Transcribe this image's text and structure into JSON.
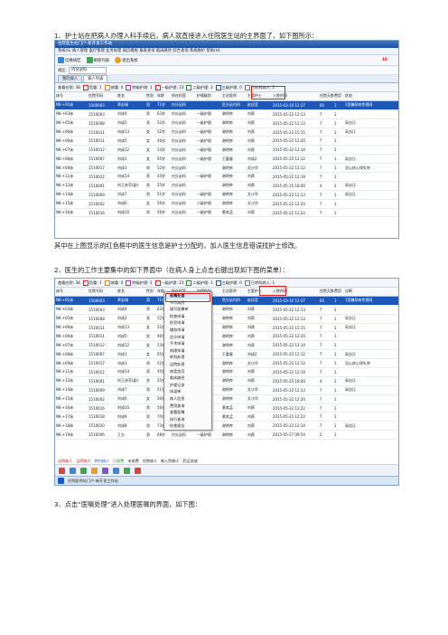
{
  "step1": "1、护士站在把病人办理入科手续后，病人就直接进入住院医生站的主界面了，如下图所示：",
  "caption1": "其中在上图显示的红色框中的医生信息是护士分配的，加入医生信息错误找护士修改。",
  "step2": "2、医生的工作主要集中的如下界面中（在病人身上点击右键出现如下图的菜单）：",
  "step3": "3、点击“医嘱处理”进入处理医嘱的界面，如下图：",
  "shot1": {
    "title": "住院医生站门户-新开发工作站",
    "menu": "系统(S)  病人管理  医疗管理  业务处理  病历模板  报表查询  临床路径  综合查询  系统维护  帮助(H)",
    "toolbar": [
      "切换病区",
      "刷新列表",
      "退出系统"
    ],
    "toolbar_count": "18",
    "filter_label": "病区:",
    "filter_value": "内分泌科",
    "tabs": [
      "我的病人",
      "病人列表"
    ],
    "status": [
      "查看在院: 38",
      "危重: 1",
      "病重: 0",
      "特级护理: 1",
      "一级护理: 23",
      "二级护理: 3",
      "三级护理: 0",
      "已转科病人: 1"
    ],
    "header": [
      "床号",
      "住院号码",
      "姓名",
      "性别",
      "年龄",
      "所在科室",
      "护理级别",
      "主治医师",
      "主管护士",
      "入院时间",
      "住院天数",
      "费用",
      "状态"
    ],
    "rows": [
      [
        "NK-+01床",
        "1500003",
        "茅宏瑞",
        "男",
        "71岁",
        "内分泌科",
        "",
        "危分泌内科",
        "赵佳莹",
        "2015-03-10 12:37",
        "60",
        "1",
        "1型糖尿病性视网"
      ],
      [
        "NK-+03床",
        "1510003",
        "刘成4",
        "男",
        "63岁",
        "内分泌科",
        "一级护理",
        "谢明库",
        "刘燕",
        "2015-05-22 12:13",
        "7",
        "1",
        ""
      ],
      [
        "NK-+05床",
        "1510008",
        "刘成2",
        "男",
        "52岁",
        "内分泌科",
        "一级护理",
        "谢明库",
        "刘燕",
        "2015-05-22 12:13",
        "7",
        "1",
        "高血压"
      ],
      [
        "NK-+06床",
        "1510011",
        "刘成13",
        "女",
        "52岁",
        "内分泌科",
        "一级护理",
        "谢明库",
        "刘燕",
        "2015-05-22 15:15",
        "7",
        "1",
        "高血压"
      ],
      [
        "NK-+06床",
        "1510011",
        "刘成5",
        "女",
        "46岁",
        "内分泌科",
        "一级护理",
        "谢明库",
        "刘燕",
        "2015-05-22 12:20",
        "7",
        "1",
        ""
      ],
      [
        "NK-+07床",
        "1510012",
        "刘成12",
        "女",
        "53岁",
        "内分泌科",
        "一级护理",
        "谢明库",
        "刘燕",
        "2015-05-22 12:14",
        "7",
        "1",
        ""
      ],
      [
        "NK-+08床",
        "1510007",
        "刘成1",
        "女",
        "65岁",
        "内分泌科",
        "一级护理",
        "王重春",
        "刘成2",
        "2015-05-22 12:12",
        "7",
        "1",
        "高血压"
      ],
      [
        "NK-+09床",
        "1510017",
        "刘成3",
        "男",
        "52岁",
        "内分泌科",
        "",
        "谢明库",
        "文沙华",
        "2015-05-22 12:12",
        "7",
        "1",
        "冠心病心律失常"
      ],
      [
        "NK-+11床",
        "1510022",
        "刘成14",
        "男",
        "45岁",
        "内分泌科",
        "一级护理",
        "谢明库",
        "刘燕",
        "2015-05-22 12:19",
        "7",
        "1",
        ""
      ],
      [
        "NK-+12床",
        "1510001",
        "刘王彦芬(副)",
        "男",
        "25岁",
        "内分泌科",
        "",
        "谢明库",
        "刘燕",
        "2015-05-25 18:40",
        "4",
        "1",
        "高血压"
      ],
      [
        "NK-+14床",
        "1510009",
        "刘成7",
        "男",
        "51岁",
        "内分泌科",
        "一级护理",
        "谢明库",
        "文沙华",
        "2015-05-22 12:13",
        "7",
        "1",
        "高血压"
      ],
      [
        "NK-+15床",
        "1510002",
        "刘成6",
        "女",
        "56岁",
        "内分泌科",
        "二级护理",
        "谢明库",
        "文沙华",
        "2015-05-22 12:20",
        "7",
        "1",
        ""
      ],
      [
        "NK-+16床",
        "1510016",
        "刘成10",
        "男",
        "56岁",
        "内分泌科",
        "一级护理",
        "黄其孟",
        "刘燕",
        "2015-05-22 12:22",
        "7",
        "1",
        ""
      ]
    ]
  },
  "shot2": {
    "status": [
      "查看在院: 38",
      "危重: 1",
      "病重: 0",
      "特级护理: 1",
      "一级护理: 23",
      "二级护理: 3",
      "三级护理: 0",
      "已转科病人: 1"
    ],
    "header": [
      "床号",
      "住院号码",
      "姓名",
      "性别",
      "年龄",
      "所在科室",
      "护理级别",
      "主治医师",
      "主管护士",
      "入院时间",
      "住院天数",
      "费用",
      "诊断"
    ],
    "rows": [
      [
        "NK-+01床",
        "1500003",
        "茅宏瑞",
        "男",
        "71岁",
        "内分泌科",
        "",
        "危分泌内科",
        "赵佳莹",
        "2015-03-10 12:37",
        "60",
        "1",
        "1型糖尿病性视网"
      ],
      [
        "NK-+03床",
        "1510003",
        "刘成4",
        "男",
        "63岁",
        "内分泌科",
        "一级护理",
        "谢明库",
        "刘燕",
        "2015-05-22 12:13",
        "7",
        "1",
        ""
      ],
      [
        "NK-+05床",
        "1510008",
        "刘成2",
        "男",
        "52岁",
        "内分泌科",
        "一级护理",
        "谢明库",
        "刘燕",
        "2015-05-22 12:13",
        "7",
        "1",
        "高血压"
      ],
      [
        "NK-+06床",
        "1510011",
        "刘成13",
        "女",
        "52岁",
        "内分泌科",
        "一级护理",
        "谢明库",
        "刘燕",
        "2015-05-22 15:15",
        "7",
        "1",
        "高血压"
      ],
      [
        "NK-+06床",
        "1510011",
        "刘成5",
        "女",
        "46岁",
        "内分泌科",
        "一级护理",
        "谢明库",
        "刘燕",
        "2015-05-22 12:20",
        "7",
        "1",
        ""
      ],
      [
        "NK-+07床",
        "1510012",
        "刘成12",
        "女",
        "53岁",
        "内分泌科",
        "一级护理",
        "谢明库",
        "刘燕",
        "2015-05-22 12:14",
        "7",
        "1",
        ""
      ],
      [
        "NK-+08床",
        "1510007",
        "刘成1",
        "女",
        "65岁",
        "内分泌科",
        "一级护理",
        "王重春",
        "刘成2",
        "2015-05-22 12:12",
        "7",
        "1",
        "高血压"
      ],
      [
        "NK-+09床",
        "1510017",
        "刘成3",
        "男",
        "52岁",
        "内分泌科",
        "",
        "谢明库",
        "文沙华",
        "2015-05-22 12:12",
        "7",
        "1",
        "冠心病心律失常"
      ],
      [
        "NK-+11床",
        "1510022",
        "刘成14",
        "男",
        "45岁",
        "内分泌科",
        "一级护理",
        "谢明库",
        "刘燕",
        "2015-05-22 12:19",
        "7",
        "1",
        ""
      ],
      [
        "NK-+12床",
        "1510001",
        "刘王彦芬(副)",
        "男",
        "25岁",
        "内分泌科",
        "",
        "谢明库",
        "刘燕",
        "2015-05-25 18:40",
        "4",
        "1",
        "高血压"
      ],
      [
        "NK-+14床",
        "1510009",
        "刘成7",
        "男",
        "51岁",
        "内分泌科",
        "一级护理",
        "谢明库",
        "文沙华",
        "2015-05-22 12:13",
        "7",
        "1",
        "高血压"
      ],
      [
        "NK-+15床",
        "1510002",
        "刘成6",
        "女",
        "56岁",
        "内分泌科",
        "二级护理",
        "谢明库",
        "文沙华",
        "2015-05-22 12:20",
        "7",
        "1",
        ""
      ],
      [
        "NK-+16床",
        "1510016",
        "刘成10",
        "男",
        "56岁",
        "内分泌科",
        "一级护理",
        "黄其孟",
        "刘燕",
        "2015-05-22 12:22",
        "7",
        "1",
        ""
      ],
      [
        "NK-+17床",
        "1510018",
        "刘成9",
        "男",
        "70岁",
        "内分泌科",
        "一级护理",
        "黄其孟",
        "刘燕",
        "2015-05-22 12:22",
        "7",
        "1",
        ""
      ],
      [
        "NK-+18床",
        "1510020",
        "刘成8",
        "男",
        "73岁",
        "内分泌科",
        "一级护理",
        "谢明库",
        "刘燕",
        "2015-05-22 12:14",
        "7",
        "1",
        "高血压"
      ],
      [
        "NK-+19床",
        "1510006",
        "王五",
        "男",
        "68岁",
        "内分泌科",
        "一级护理",
        "谢明库",
        "刘燕",
        "2015-05-27 09:54",
        "2",
        "1",
        ""
      ]
    ],
    "context_menu": [
      "医嘱处理",
      "书写病历",
      "填写医嘱单",
      "检查申请",
      "检验申请",
      "输血申请",
      "会诊申请",
      "手术申请",
      "病理申请",
      "转科处理",
      "出院处理",
      "病案首页",
      "临床路径",
      "护理记录",
      "体温单",
      "病人信息",
      "费用查询",
      "查看医嘱",
      "执行查询",
      "检查报告"
    ],
    "legend": [
      "出院病人",
      "出院病人",
      "转科病人",
      "已收费",
      "未收费",
      "在院病人",
      "新入院病人",
      "药品发放"
    ],
    "bottom": [
      "住院医师站门户-新开发工作站"
    ]
  }
}
